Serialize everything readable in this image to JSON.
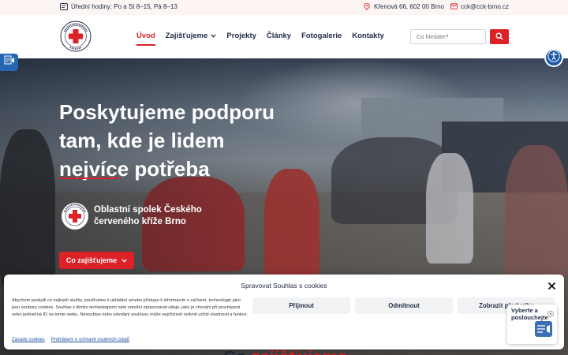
{
  "topbar": {
    "hours": "Úřední hodiny: Po a St 8–15, Pá 8–13",
    "address": "Křenová 66, 602 00 Brno",
    "email": "cck@cck-brno.cz"
  },
  "logo": {
    "alt_lines": [
      "ČESKÝ ČERVENÝ KŘÍŽ",
      "BRNO"
    ]
  },
  "nav": {
    "items": [
      {
        "label": "Úvod",
        "active": true
      },
      {
        "label": "Zajišťujeme",
        "dropdown": true
      },
      {
        "label": "Projekty"
      },
      {
        "label": "Články"
      },
      {
        "label": "Fotogalerie"
      },
      {
        "label": "Kontakty"
      }
    ]
  },
  "search": {
    "placeholder": "Co hledáte?"
  },
  "hero": {
    "title": "Poskytujeme podporu tam, kde je lidem nejvíce potřeba",
    "org_name": "Oblastní spolek Českého červeného kříže Brno",
    "cta_label": "Co zajišťujeme"
  },
  "section": {
    "heading_dark": "Co",
    "heading_red": "zajišťujeme"
  },
  "cookie": {
    "title": "Spravovat Souhlas s cookies",
    "text": "Abychom poskytli co nejlepší služby, používáme k ukládání a/nebo přístupu k informacím o zařízení, technologie jako jsou soubory cookies. Souhlas s těmito technologiemi nám umožní zpracovávat údaje, jako je chování při procházení nebo jedinečná ID na tomto webu. Nesouhlas nebo odvolání souhlasu může nepříznivě ovlivnit určité vlastnosti a funkce.",
    "accept_label": "Přijmout",
    "reject_label": "Odmítnout",
    "prefs_label": "Zobrazit předvolby",
    "link_cookies": "Zásady cookies",
    "link_privacy": "Prohlášení o ochraně osobních údajů"
  },
  "readaloud": {
    "label": "Vyberte a poslouchejte"
  },
  "colors": {
    "brand_red": "#dc2127",
    "navy": "#1f2a44",
    "accessibility_blue": "#1c5aa8"
  }
}
